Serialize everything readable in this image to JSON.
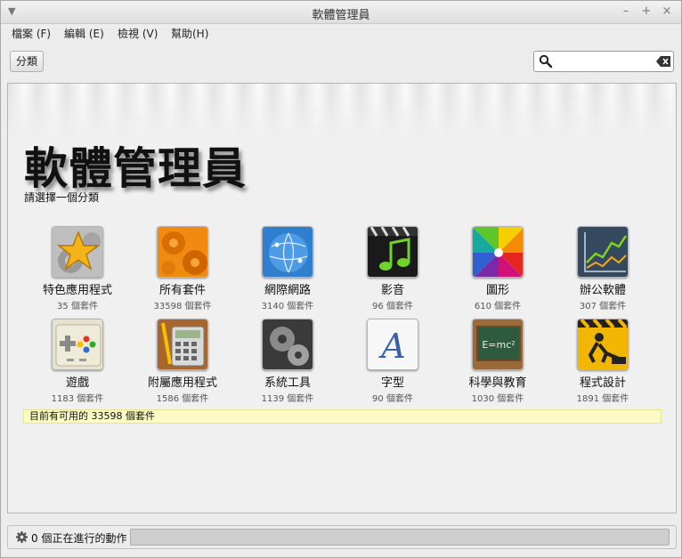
{
  "window": {
    "title": "軟體管理員"
  },
  "menubar": {
    "file": "檔案 (F)",
    "edit": "編輯 (E)",
    "view": "檢視 (V)",
    "help": "幫助(H)"
  },
  "toolbar": {
    "category_button": "分類",
    "search_value": ""
  },
  "main": {
    "heading": "軟體管理員",
    "subheading": "請選擇一個分類",
    "categories": [
      {
        "name": "特色應用程式",
        "count": "35 個套件",
        "icon": "star-gear-icon"
      },
      {
        "name": "所有套件",
        "count": "33598 個套件",
        "icon": "orange-gears-icon"
      },
      {
        "name": "網際網路",
        "count": "3140 個套件",
        "icon": "globe-network-icon"
      },
      {
        "name": "影音",
        "count": "96 個套件",
        "icon": "clapperboard-music-icon"
      },
      {
        "name": "圖形",
        "count": "610 個套件",
        "icon": "color-swirl-icon"
      },
      {
        "name": "辦公軟體",
        "count": "307 個套件",
        "icon": "line-chart-icon"
      },
      {
        "name": "遊戲",
        "count": "1183 個套件",
        "icon": "gamepad-icon"
      },
      {
        "name": "附屬應用程式",
        "count": "1586 個套件",
        "icon": "calculator-pencil-icon"
      },
      {
        "name": "系統工具",
        "count": "1139 個套件",
        "icon": "dark-gears-icon"
      },
      {
        "name": "字型",
        "count": "90 個套件",
        "icon": "font-letter-icon"
      },
      {
        "name": "科學與教育",
        "count": "1030 個套件",
        "icon": "chalkboard-formula-icon"
      },
      {
        "name": "程式設計",
        "count": "1891 個套件",
        "icon": "construction-worker-icon"
      }
    ],
    "available_text": "目前有可用的 33598 個套件"
  },
  "status": {
    "text": "0 個正在進行的動作"
  }
}
